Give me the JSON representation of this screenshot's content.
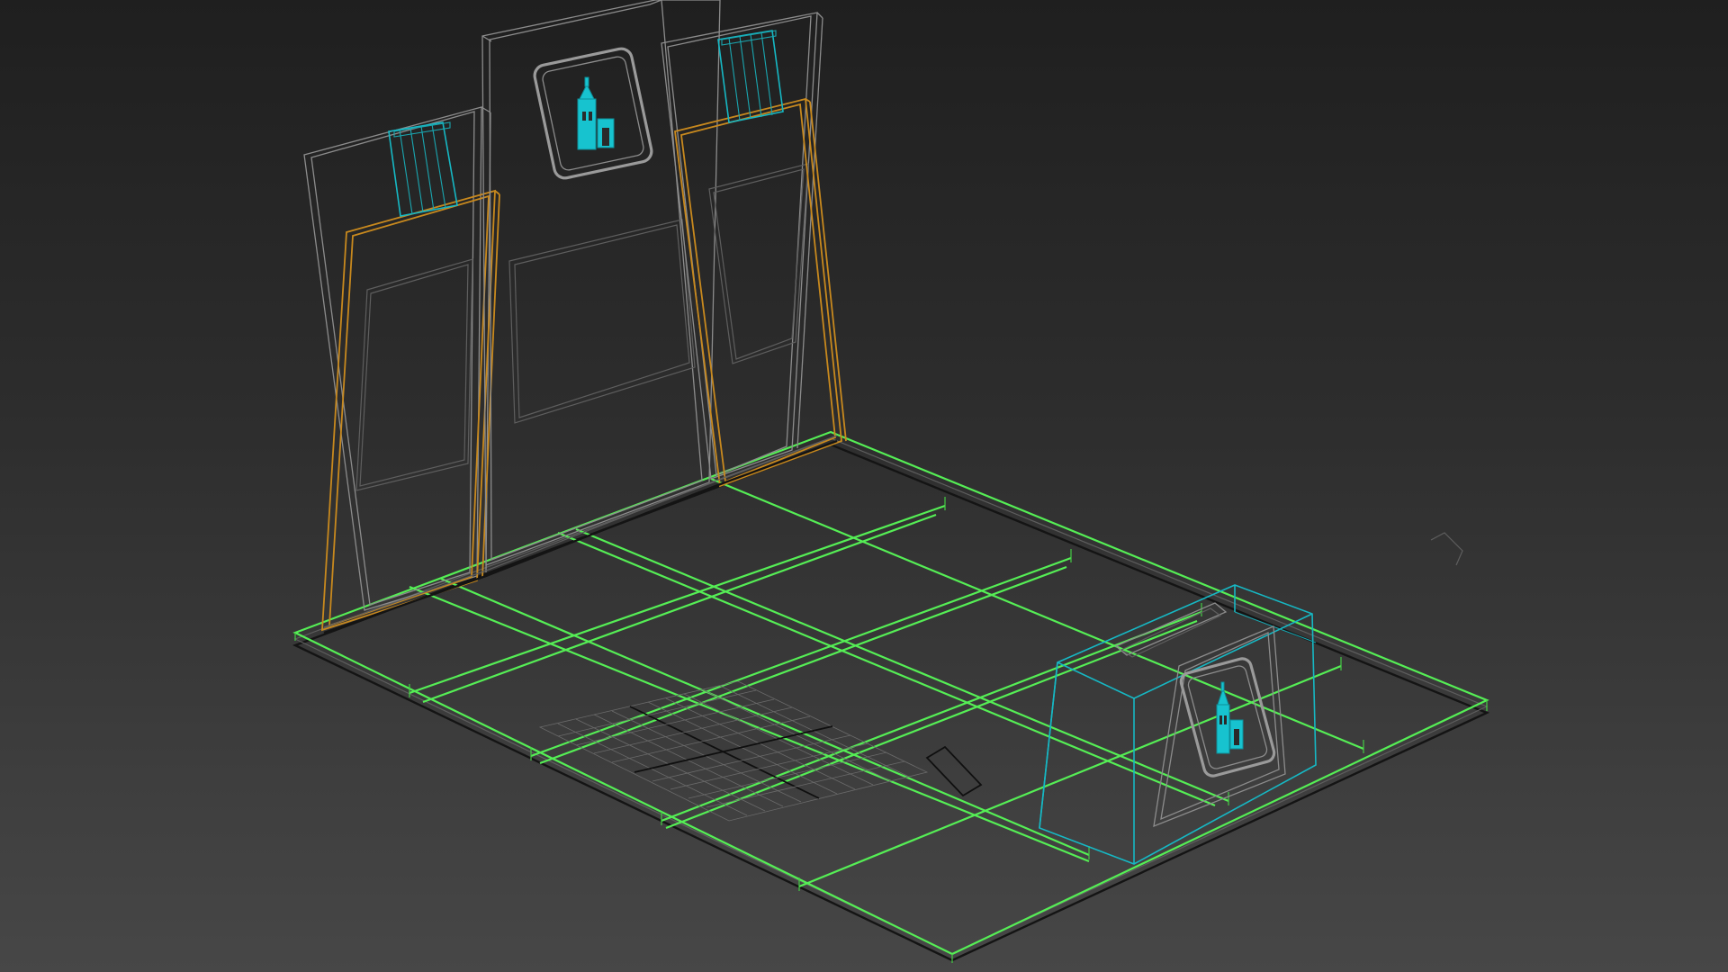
{
  "viewport": {
    "background_top": "#1f1f1f",
    "background_bottom": "#474747",
    "wire_colors": {
      "floor_grid": "#55ee55",
      "walls": "#8c8c8c",
      "wall_frames": "#c8891e",
      "lights_and_logos": "#16b8c4"
    }
  },
  "scene": {
    "objects": [
      "floor-platform",
      "back-wall-left-panel",
      "back-wall-center-panel",
      "back-wall-right-panel",
      "logo-sign-center",
      "spotlight-left",
      "spotlight-right",
      "reception-counter",
      "floor-tile-grid"
    ],
    "icons": {
      "logo": "building-logo-icon"
    }
  }
}
